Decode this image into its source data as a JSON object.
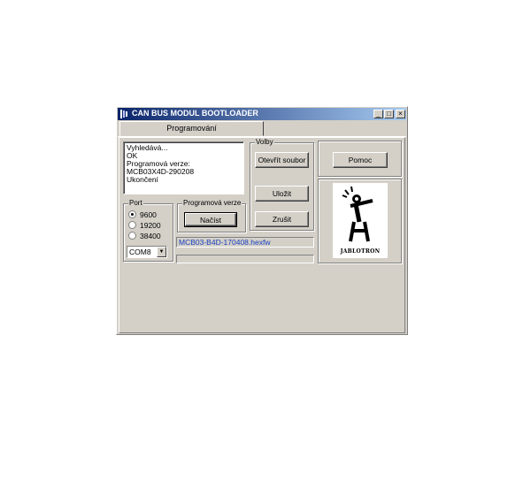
{
  "window": {
    "title": "CAN BUS MODUL BOOTLOADER",
    "controls": {
      "minimize": "_",
      "maximize": "□",
      "close": "×"
    }
  },
  "tabs": [
    {
      "label": "Programování",
      "selected": true
    }
  ],
  "log": {
    "lines": [
      "Vyhledává...",
      "OK",
      "Programová verze:",
      "MCB03X4D-290208",
      "Ukončení"
    ]
  },
  "volby": {
    "legend": "Volby",
    "open_button": "Otevřít soubor",
    "save_button": "Uložit",
    "cancel_button": "Zrušit"
  },
  "help_button": "Pomoc",
  "port": {
    "legend": "Port",
    "options": [
      "9600",
      "19200",
      "38400"
    ],
    "selected": "9600",
    "com_value": "COM8"
  },
  "program_version": {
    "legend": "Programová verze",
    "load_button": "Načíst"
  },
  "file_name": "MCB03-B4D-170408.hexfw",
  "progress": 0,
  "logo": {
    "brand": "JABLOTRON"
  },
  "colors": {
    "title_start": "#0a246a",
    "title_end": "#a6caf0",
    "face": "#d4d0c8",
    "file_text": "#1a40c0"
  }
}
